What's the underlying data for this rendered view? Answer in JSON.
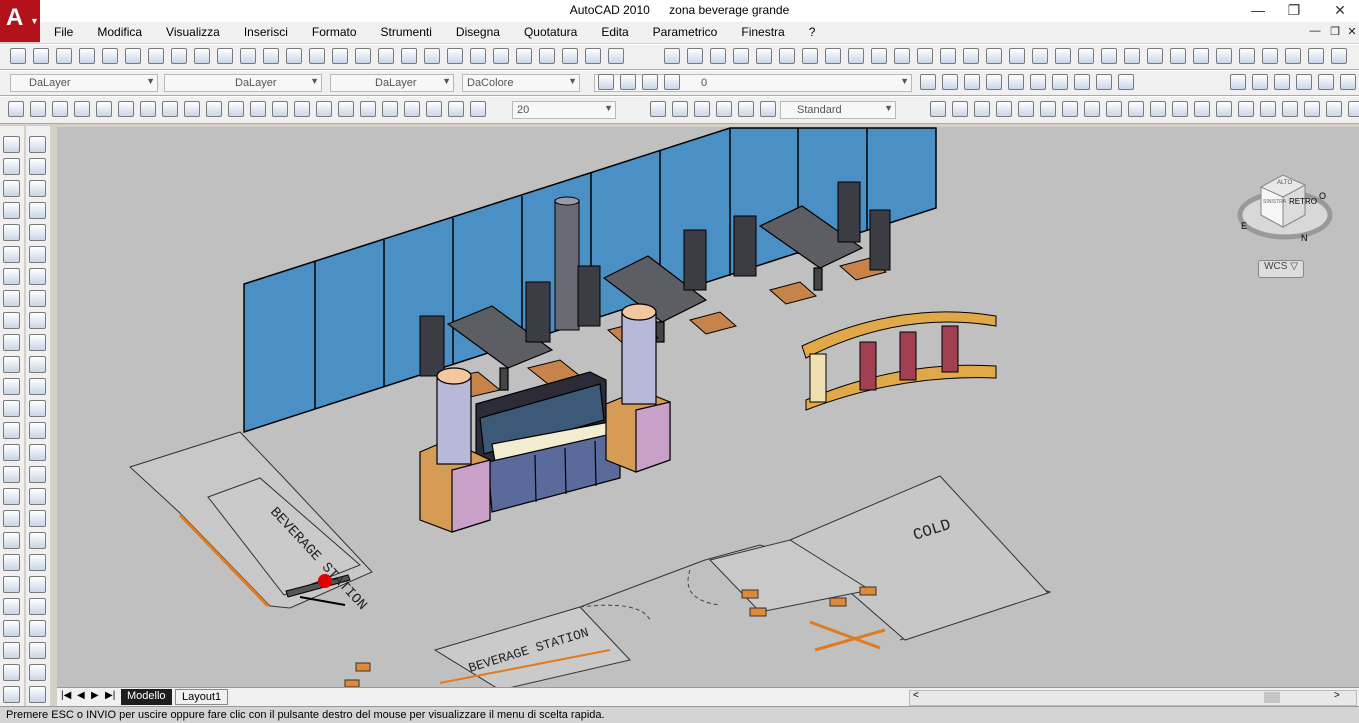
{
  "window": {
    "app_name": "AutoCAD 2010",
    "document_name": "zona beverage grande",
    "minimize": "—",
    "restore": "❐",
    "close": "✕"
  },
  "menu": {
    "items": [
      "File",
      "Modifica",
      "Visualizza",
      "Inserisci",
      "Formato",
      "Strumenti",
      "Disegna",
      "Quotatura",
      "Edita",
      "Parametrico",
      "Finestra",
      "?"
    ]
  },
  "properties_bar": {
    "color_value": "DaLayer",
    "linetype_value": "DaLayer",
    "lineweight_value": "DaLayer",
    "plotstyle_value": "DaColore",
    "layer_value": "0"
  },
  "dimension_bar": {
    "dim_scale": "20",
    "dim_style": "Standard"
  },
  "viewcube": {
    "face_label": "RETRO",
    "top_label": "ALTO",
    "side_label": "SINISTRA",
    "compass_n": "N",
    "compass_e": "E",
    "compass_o": "O",
    "wcs_label": "WCS"
  },
  "drawing_text": {
    "beverage_station_1": "BEVERAGE STATION",
    "beverage_station_2": "BEVERAGE STATION",
    "cold": "COLD"
  },
  "tabs": {
    "model": "Modello",
    "layout1": "Layout1"
  },
  "status": {
    "message": "Premere ESC o INVIO per uscire oppure fare clic con il pulsante destro del mouse per visualizzare il menu di scelta rapida."
  },
  "colors": {
    "app_red": "#b3121b",
    "viewport_bg": "#c0c0c0",
    "wall_blue": "#4a90c4",
    "table_gray": "#5d5d64",
    "chair_orange": "#c8834a",
    "column_pink": "#c9a0c8",
    "base_orange": "#d69b55"
  }
}
